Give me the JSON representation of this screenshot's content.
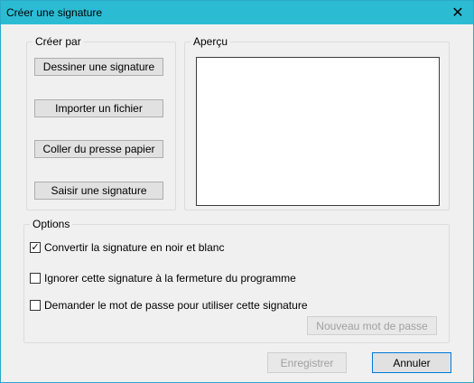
{
  "window": {
    "title": "Créer une signature",
    "close_icon": "close-icon"
  },
  "create_group": {
    "legend": "Créer par",
    "buttons": [
      "Dessiner une signature",
      "Importer un fichier",
      "Coller du presse papier",
      "Saisir une signature"
    ]
  },
  "preview_group": {
    "legend": "Aperçu"
  },
  "options_group": {
    "legend": "Options",
    "checkboxes": [
      {
        "label": "Convertir la signature en noir et blanc",
        "checked": true
      },
      {
        "label": "Ignorer cette signature à la fermeture du programme",
        "checked": false
      },
      {
        "label": "Demander le mot de passe pour utiliser cette signature",
        "checked": false
      }
    ],
    "new_password_button": "Nouveau mot de passe"
  },
  "footer": {
    "save_button": "Enregistrer",
    "cancel_button": "Annuler"
  },
  "colors": {
    "titlebar": "#2bbcd4",
    "primary_border": "#0078d7"
  }
}
